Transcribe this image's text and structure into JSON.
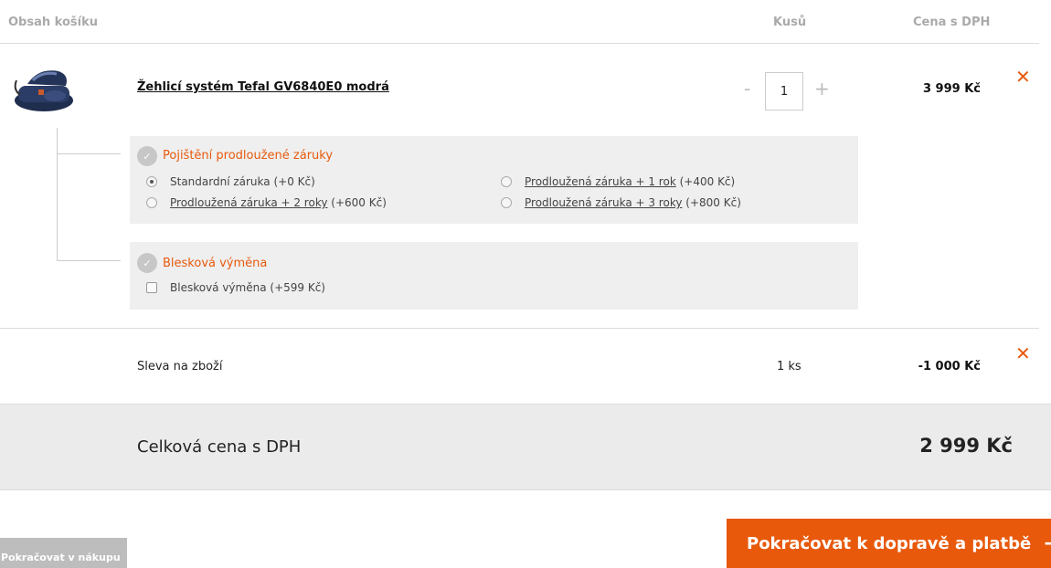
{
  "header": {
    "content_label": "Obsah košíku",
    "qty_label": "Kusů",
    "price_label": "Cena s DPH"
  },
  "item": {
    "image_icon": "steam-iron-product-image",
    "name": "Žehlicí systém Tefal GV6840E0 modrá",
    "qty_minus": "-",
    "qty_value": "1",
    "qty_plus": "+",
    "price": "3 999 Kč",
    "remove_icon": "✕"
  },
  "warranty": {
    "icon": "shield-check-icon",
    "title": "Pojištění prodloužené záruky",
    "options": [
      {
        "link": "",
        "text": "Standardní záruka",
        "extra": "(+0 Kč)",
        "selected": true
      },
      {
        "link": "Prodloužená záruka + 1 rok",
        "text": "",
        "extra": "(+400 Kč)",
        "selected": false
      },
      {
        "link": "Prodloužená záruka + 2 roky",
        "text": "",
        "extra": "(+600 Kč)",
        "selected": false
      },
      {
        "link": "Prodloužená záruka + 3 roky",
        "text": "",
        "extra": "(+800 Kč)",
        "selected": false
      }
    ]
  },
  "quick_swap": {
    "icon": "shield-check-icon",
    "title": "Blesková výměna",
    "option_label": "Blesková výměna (+599 Kč)",
    "checked": false
  },
  "discount": {
    "label": "Sleva na zboží",
    "qty": "1 ks",
    "price": "-1 000 Kč",
    "remove_icon": "✕"
  },
  "total": {
    "label": "Celková cena s DPH",
    "value": "2 999 Kč"
  },
  "buttons": {
    "back": "Pokračovat v nákupu",
    "next": "Pokračovat k dopravě a platbě",
    "next_icon": "→"
  },
  "colors": {
    "accent": "#e8590c",
    "band": "#ebebeb",
    "service_box": "#efefef"
  }
}
